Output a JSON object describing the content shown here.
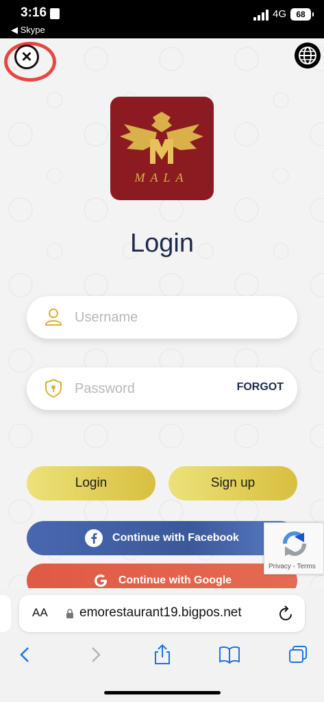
{
  "status": {
    "time": "3:16",
    "back_app": "◀ Skype",
    "network": "4G",
    "battery": "68"
  },
  "login": {
    "logo_text": "MALA",
    "title": "Login",
    "username_placeholder": "Username",
    "password_placeholder": "Password",
    "forgot_label": "FORGOT",
    "login_button": "Login",
    "signup_button": "Sign up",
    "facebook_button": "Continue with Facebook",
    "google_button": "Continue with Google",
    "recaptcha_links": "Privacy - Terms"
  },
  "browser": {
    "aa_label": "AA",
    "url": "emorestaurant19.bigpos.net"
  },
  "colors": {
    "brand_red": "#8c1b21",
    "gold": "#d8bf3e",
    "navy": "#1c2a4a",
    "facebook": "#3b5998",
    "google": "#e05a45",
    "ios_blue": "#1a73e8"
  },
  "icons": [
    "close-icon",
    "globe-icon",
    "user-icon",
    "shield-lock-icon",
    "facebook-icon",
    "google-icon",
    "lock-icon",
    "reload-icon",
    "back-icon",
    "forward-icon",
    "share-icon",
    "bookmarks-icon",
    "tabs-icon"
  ]
}
